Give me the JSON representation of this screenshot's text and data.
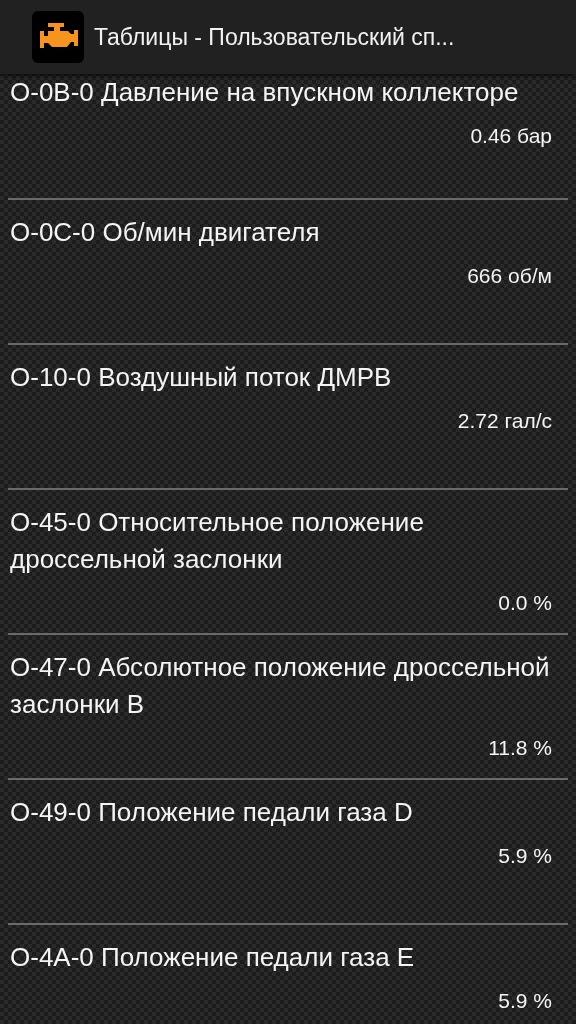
{
  "action_bar": {
    "title": "Таблицы - Пользовательский сп..."
  },
  "rows": [
    {
      "title": "O-0B-0 Давление на впускном коллекторе",
      "value": "0.46 бар"
    },
    {
      "title": "O-0C-0 Об/мин двигателя",
      "value": "666 об/м"
    },
    {
      "title": "O-10-0 Воздушный поток ДМРВ",
      "value": "2.72 гал/с"
    },
    {
      "title": "O-45-0 Относительное положение дроссельной заслонки",
      "value": "0.0 %"
    },
    {
      "title": "O-47-0 Абсолютное положение дроссельной заслонки B",
      "value": "11.8 %"
    },
    {
      "title": "O-49-0 Положение педали газа D",
      "value": "5.9 %"
    },
    {
      "title": "O-4A-0 Положение педали газа E",
      "value": "5.9 %"
    }
  ]
}
